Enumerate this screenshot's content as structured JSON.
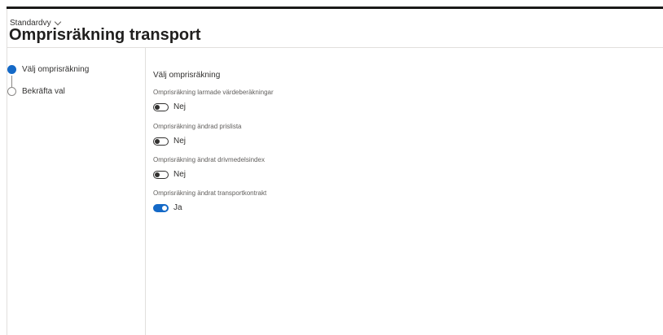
{
  "header": {
    "view_name": "Standardvy",
    "title": "Omprisräkning transport"
  },
  "steps": [
    {
      "label": "Välj omprisräkning",
      "state": "active"
    },
    {
      "label": "Bekräfta val",
      "state": "inactive"
    }
  ],
  "main": {
    "section_title": "Välj omprisräkning",
    "fields": [
      {
        "label": "Omprisräkning larmade värdeberäkningar",
        "value": "Nej",
        "on": false
      },
      {
        "label": "Omprisräkning ändrad prislista",
        "value": "Nej",
        "on": false
      },
      {
        "label": "Omprisräkning ändrat drivmedelsindex",
        "value": "Nej",
        "on": false
      },
      {
        "label": "Omprisräkning ändrat transportkontrakt",
        "value": "Ja",
        "on": true
      }
    ]
  },
  "colors": {
    "accent": "#1469c7",
    "text": "#323130",
    "border": "#e1dfdd"
  },
  "icons": {
    "view_dropdown": "chevron-down-icon",
    "step_active": "filled-circle-icon",
    "step_inactive": "empty-circle-icon"
  }
}
